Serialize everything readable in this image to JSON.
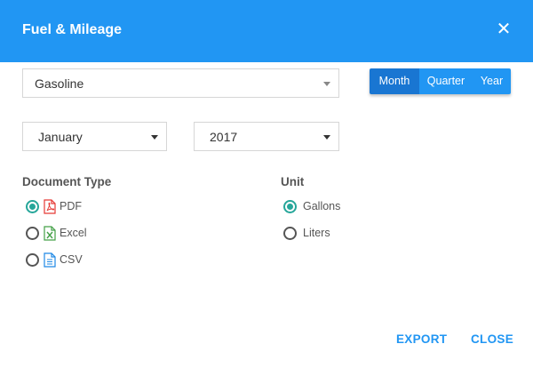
{
  "dialog": {
    "title": "Fuel & Mileage",
    "close_icon": "close-icon"
  },
  "fuel_select": {
    "value": "Gasoline"
  },
  "period": {
    "options": [
      "Month",
      "Quarter",
      "Year"
    ],
    "selected": "Month"
  },
  "month_select": {
    "value": "January"
  },
  "year_select": {
    "value": "2017"
  },
  "document_type": {
    "label": "Document Type",
    "options": [
      {
        "label": "PDF",
        "icon": "pdf-file-icon",
        "checked": true
      },
      {
        "label": "Excel",
        "icon": "excel-file-icon",
        "checked": false
      },
      {
        "label": "CSV",
        "icon": "csv-file-icon",
        "checked": false
      }
    ]
  },
  "unit": {
    "label": "Unit",
    "options": [
      {
        "label": "Gallons",
        "checked": true
      },
      {
        "label": "Liters",
        "checked": false
      }
    ]
  },
  "actions": {
    "export": "EXPORT",
    "close": "CLOSE"
  },
  "colors": {
    "primary": "#2196f3",
    "primary_dark": "#1976d2",
    "radio_checked": "#26a69a",
    "pdf": "#e53935",
    "excel": "#43a047",
    "csv": "#1e88e5"
  }
}
